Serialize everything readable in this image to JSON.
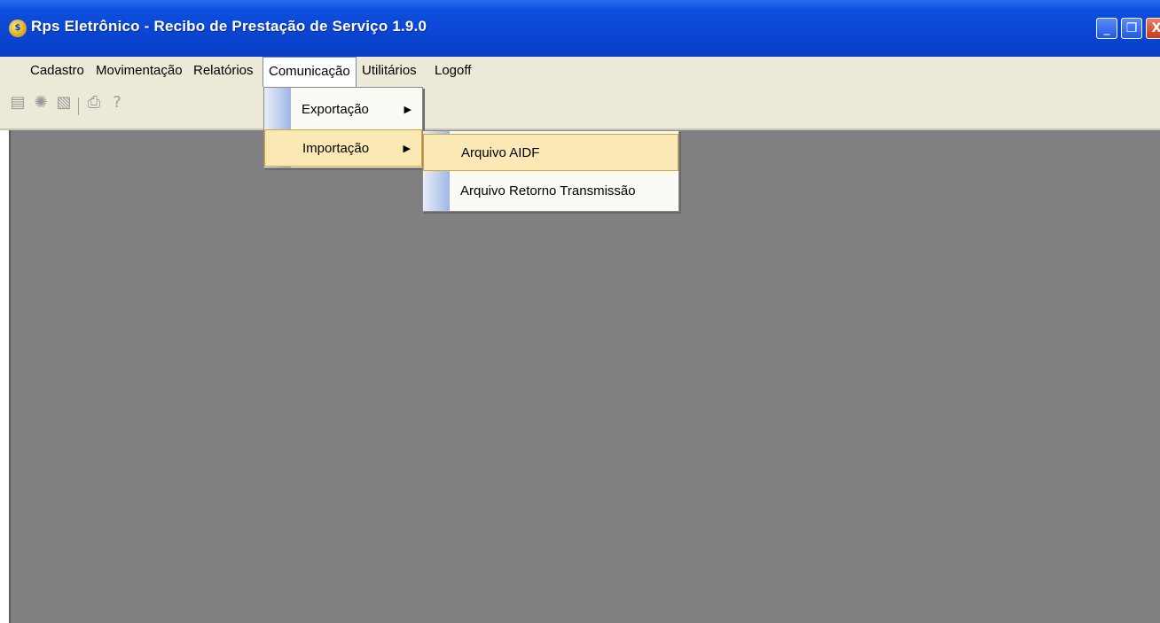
{
  "window": {
    "title": "Rps Eletrônico - Recibo de Prestação de Serviço 1.9.0",
    "icon": "app-coin-icon",
    "controls": {
      "minimize": "_",
      "restore": "❐",
      "close": "X"
    }
  },
  "menubar": {
    "items": [
      "Cadastro",
      "Movimentação",
      "Relatórios",
      "Comunicação",
      "Utilitários",
      "Logoff"
    ],
    "active": "Comunicação"
  },
  "toolbar": {
    "icons": [
      "save-icon",
      "settings-icon",
      "edit-icon",
      "print-icon",
      "help-icon"
    ]
  },
  "comunicacao_menu": {
    "items": [
      {
        "label": "Exportação",
        "has_submenu": true
      },
      {
        "label": "Importação",
        "has_submenu": true,
        "highlighted": true
      }
    ]
  },
  "importacao_menu": {
    "items": [
      {
        "label": "Arquivo AIDF",
        "highlighted": true
      },
      {
        "label": "Arquivo Retorno Transmissão"
      }
    ]
  },
  "colors": {
    "titlebar": "#0a45d2",
    "menubar": "#ece9d8",
    "workspace": "#808080",
    "highlight": "#fbe9b5"
  }
}
